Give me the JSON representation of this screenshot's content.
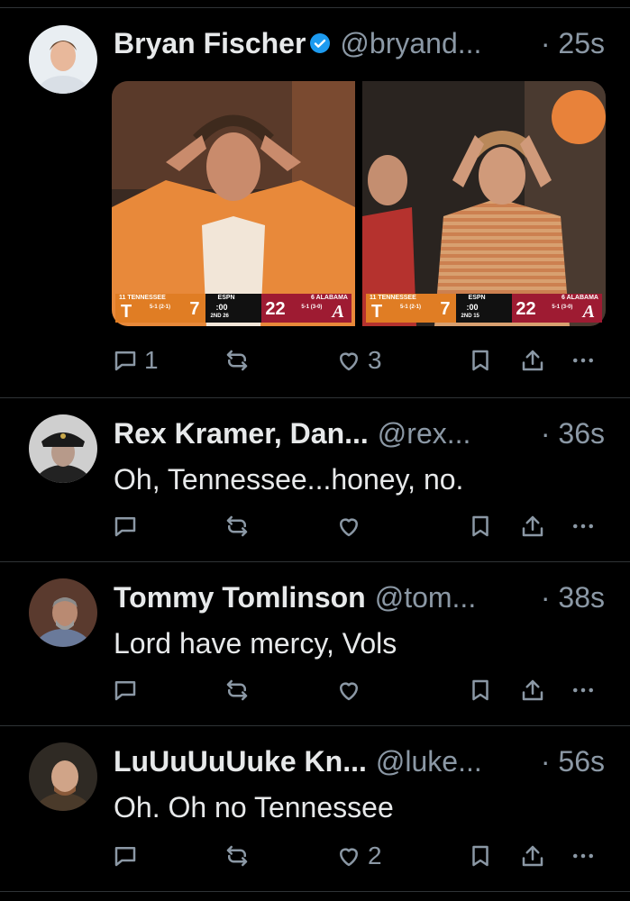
{
  "tweets": [
    {
      "name": "Bryan Fischer",
      "handle": "@bryand...",
      "time": "· 25s",
      "verified": true,
      "replies": "1",
      "likes": "3",
      "media": [
        {
          "home": "11 TENNESSEE",
          "home_rec": "5-1\n(2-1)",
          "home_score": "7",
          "network": "ESPN",
          "clock": ":00",
          "period": "2ND 26",
          "away_score": "22",
          "away": "6 ALABAMA",
          "away_rec": "5-1\n(3-0)"
        },
        {
          "home": "11 TENNESSEE",
          "home_rec": "5-1\n(2-1)",
          "home_score": "7",
          "network": "ESPN",
          "clock": ":00",
          "period": "2ND 15",
          "away_score": "22",
          "away": "6 ALABAMA",
          "away_rec": "5-1\n(3-0)"
        }
      ]
    },
    {
      "name": "Rex Kramer, Dan...",
      "handle": "@rex...",
      "time": "· 36s",
      "text": "Oh, Tennessee...honey, no."
    },
    {
      "name": "Tommy Tomlinson",
      "handle": "@tom...",
      "time": "· 38s",
      "text": "Lord have mercy, Vols"
    },
    {
      "name": "LuUuUuUuke Kn...",
      "handle": "@luke...",
      "time": "· 56s",
      "text": "Oh. Oh no Tennessee",
      "likes": "2"
    }
  ],
  "colors": {
    "background": "#000000",
    "text": "#e7e9ea",
    "muted": "#8b98a5",
    "verified": "#1d9bf0",
    "tennessee": "#e07d24",
    "alabama": "#9e1b32"
  },
  "icons": [
    "reply-icon",
    "retweet-icon",
    "like-icon",
    "bookmark-icon",
    "share-icon",
    "more-icon",
    "verified-badge-icon"
  ]
}
